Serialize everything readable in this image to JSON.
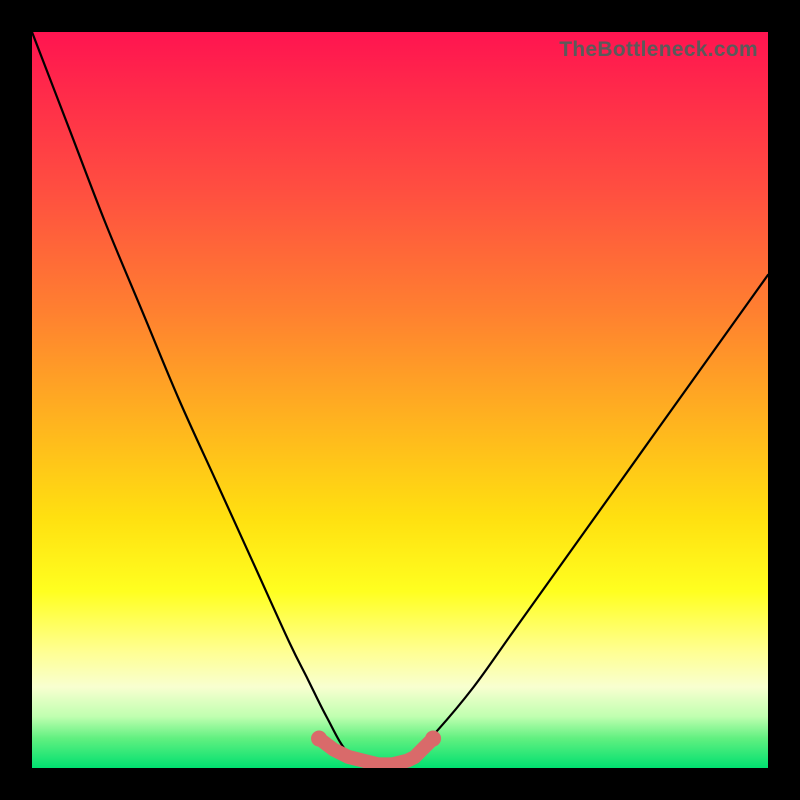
{
  "attribution": "TheBottleneck.com",
  "colors": {
    "frame": "#000000",
    "gradient_stops": [
      "#ff1450",
      "#ff2a4a",
      "#ff5040",
      "#ff8030",
      "#ffb020",
      "#ffe010",
      "#ffff20",
      "#ffff90",
      "#f8ffd0",
      "#c0ffb0",
      "#60f080",
      "#00e070"
    ],
    "curve": "#000000",
    "marker": "#d96a6a"
  },
  "chart_data": {
    "type": "line",
    "title": "",
    "xlabel": "",
    "ylabel": "",
    "xlim": [
      0,
      100
    ],
    "ylim": [
      0,
      100
    ],
    "grid": false,
    "legend": false,
    "series": [
      {
        "name": "bottleneck-curve",
        "x": [
          0,
          5,
          10,
          15,
          20,
          25,
          30,
          35,
          37.5,
          40,
          43,
          47,
          50,
          52,
          55,
          60,
          65,
          70,
          75,
          80,
          85,
          90,
          95,
          100
        ],
        "values": [
          100,
          87,
          74,
          62,
          50,
          39,
          28,
          17,
          12,
          7,
          2,
          0,
          0,
          2,
          5,
          11,
          18,
          25,
          32,
          39,
          46,
          53,
          60,
          67
        ]
      },
      {
        "name": "bottom-markers",
        "x": [
          39,
          41,
          43,
          45,
          47,
          49,
          51,
          52,
          53,
          54.5
        ],
        "values": [
          4,
          2.5,
          1.5,
          1,
          0.5,
          0.5,
          1,
          1.5,
          2.5,
          4
        ]
      }
    ],
    "annotations": [
      {
        "text": "TheBottleneck.com",
        "pos": "top-right"
      }
    ]
  }
}
